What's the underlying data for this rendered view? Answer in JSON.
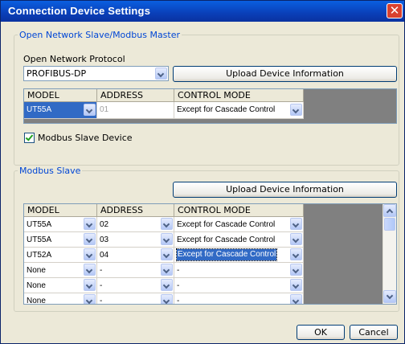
{
  "window": {
    "title": "Connection Device Settings"
  },
  "master": {
    "legend": "Open Network Slave/Modbus Master",
    "protocol_label": "Open Network Protocol",
    "protocol_value": "PROFIBUS-DP",
    "upload_label": "Upload Device Information",
    "columns": [
      "MODEL",
      "ADDRESS",
      "CONTROL MODE"
    ],
    "row": {
      "model": "UT55A",
      "address": "01",
      "mode": "Except for Cascade Control"
    },
    "checkbox_label": "Modbus Slave Device",
    "checkbox_checked": true
  },
  "slave": {
    "legend": "Modbus Slave",
    "upload_label": "Upload Device Information",
    "columns": [
      "MODEL",
      "ADDRESS",
      "CONTROL MODE"
    ],
    "rows": [
      {
        "model": "UT55A",
        "address": "02",
        "mode": "Except for Cascade Control"
      },
      {
        "model": "UT55A",
        "address": "03",
        "mode": "Except for Cascade Control"
      },
      {
        "model": "UT52A",
        "address": "04",
        "mode": "Except for Cascade Control"
      },
      {
        "model": "None",
        "address": "-",
        "mode": "-"
      },
      {
        "model": "None",
        "address": "-",
        "mode": "-"
      },
      {
        "model": "None",
        "address": "-",
        "mode": "-"
      }
    ]
  },
  "footer": {
    "ok_label": "OK",
    "cancel_label": "Cancel"
  }
}
